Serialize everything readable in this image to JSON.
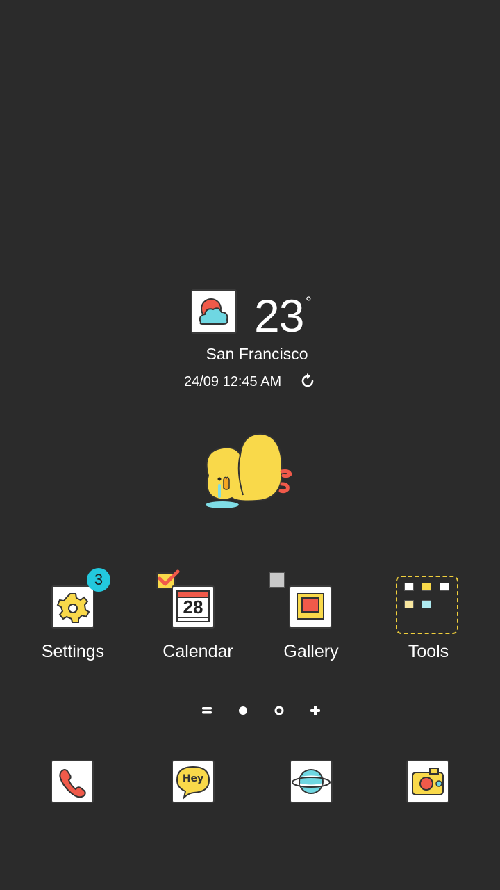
{
  "weather": {
    "temperature": "23",
    "degree_symbol": "°",
    "city": "San Francisco",
    "datetime": "24/09 12:45 AM",
    "condition_icon": "sun-cloud-icon",
    "refresh_icon": "refresh-icon"
  },
  "apps": [
    {
      "label": "Settings",
      "icon": "gear-icon",
      "badge": "3"
    },
    {
      "label": "Calendar",
      "icon": "calendar-icon",
      "date": "28"
    },
    {
      "label": "Gallery",
      "icon": "picture-frame-icon"
    },
    {
      "label": "Tools",
      "icon": "folder-icon"
    }
  ],
  "page_indicators": [
    "menu-page",
    "page-1-active",
    "page-2",
    "add-page"
  ],
  "dock": [
    {
      "name": "phone",
      "icon": "phone-icon"
    },
    {
      "name": "messages",
      "icon": "hey-bubble-icon",
      "text": "Hey"
    },
    {
      "name": "internet",
      "icon": "planet-icon"
    },
    {
      "name": "camera",
      "icon": "camera-icon"
    }
  ],
  "colors": {
    "background": "#2b2b2b",
    "badge": "#23c8dd",
    "accent_yellow": "#f9d94a",
    "accent_red": "#f05a4a",
    "accent_cyan": "#5fd6e0"
  }
}
